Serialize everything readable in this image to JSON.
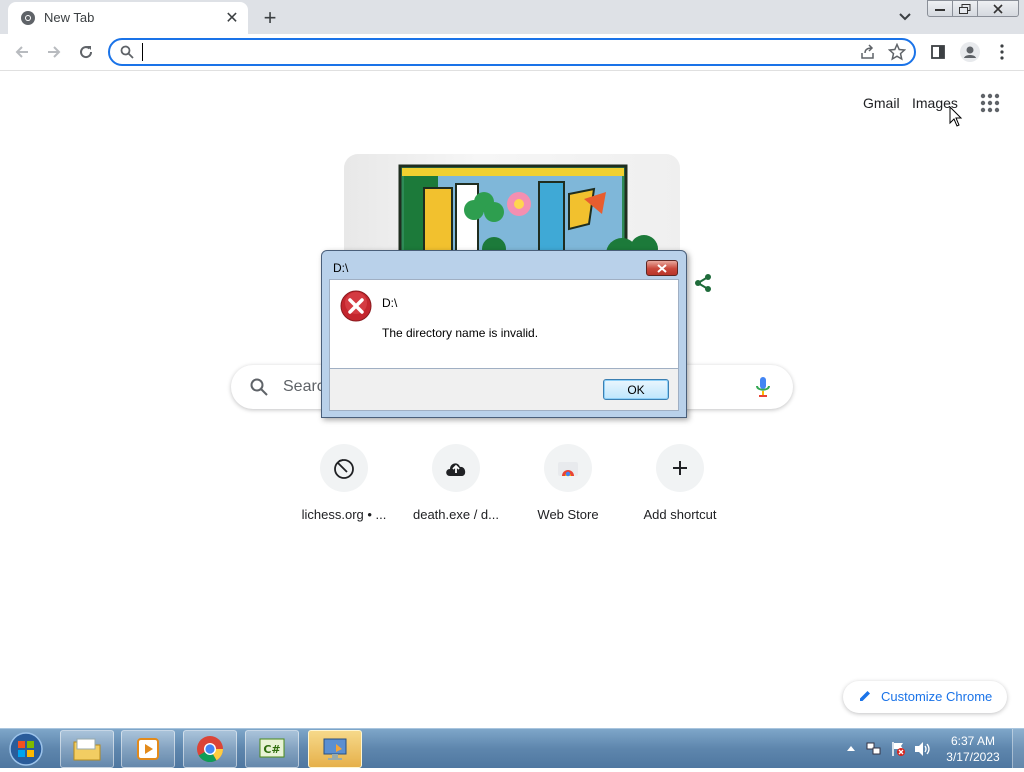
{
  "browser": {
    "tab": {
      "title": "New Tab"
    },
    "omnibox": {
      "value": "",
      "placeholder": ""
    }
  },
  "ntp": {
    "gmail": "Gmail",
    "images": "Images",
    "search_placeholder": "Searc",
    "shortcuts": [
      {
        "label": "lichess.org • ...",
        "icon": "lichess-icon"
      },
      {
        "label": "death.exe / d...",
        "icon": "upload-cloud-icon"
      },
      {
        "label": "Web Store",
        "icon": "web-store-icon"
      },
      {
        "label": "Add shortcut",
        "icon": "plus-icon"
      }
    ],
    "customize_label": "Customize Chrome"
  },
  "dialog": {
    "title": "D:\\",
    "path": "D:\\",
    "message": "The directory name is invalid.",
    "ok_label": "OK"
  },
  "taskbar": {
    "time": "6:37 AM",
    "date": "3/17/2023",
    "pinned": [
      "file-explorer-icon",
      "media-player-icon",
      "chrome-icon",
      "csharp-icon",
      "remote-desktop-icon"
    ]
  },
  "colors": {
    "accent": "#1a73e8",
    "tabstrip": "#dee1e6",
    "error_red": "#c4262e"
  }
}
